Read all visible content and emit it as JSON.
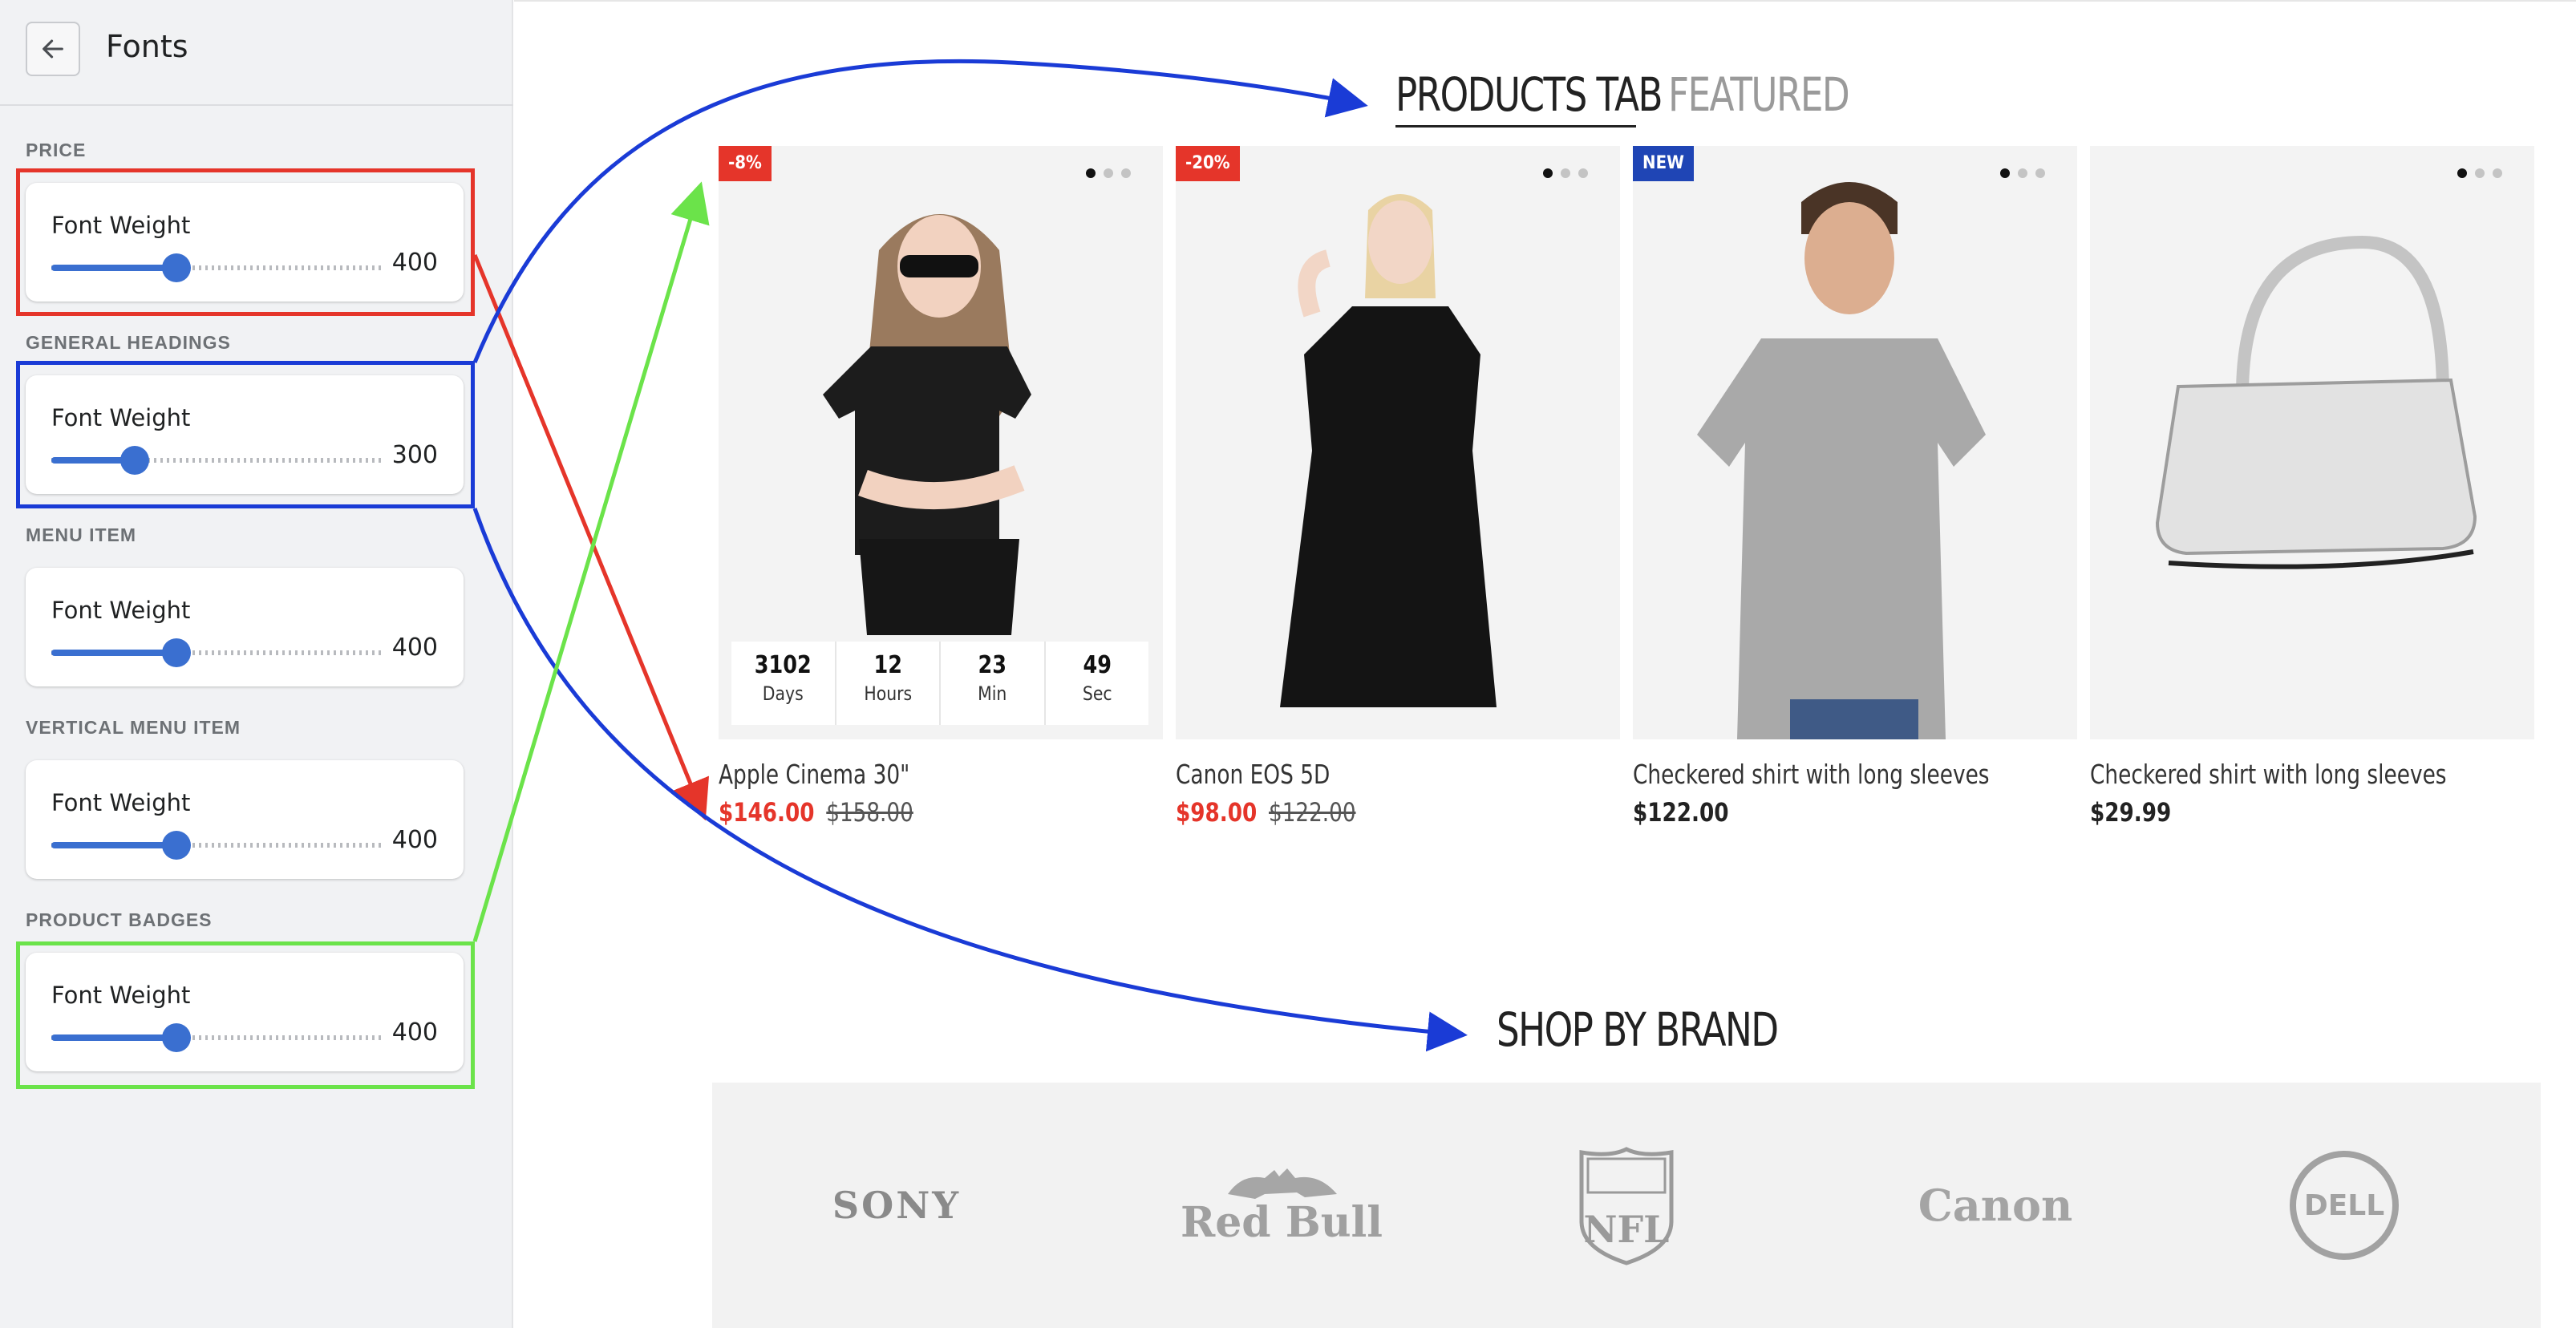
{
  "sidebar": {
    "title": "Fonts",
    "back_icon": "arrow-left-icon",
    "sections": [
      {
        "label": "PRICE",
        "control": {
          "label": "Font Weight",
          "value": "400",
          "fraction": 0.375
        }
      },
      {
        "label": "GENERAL HEADINGS",
        "control": {
          "label": "Font Weight",
          "value": "300",
          "fraction": 0.25
        }
      },
      {
        "label": "MENU ITEM",
        "control": {
          "label": "Font Weight",
          "value": "400",
          "fraction": 0.375
        }
      },
      {
        "label": "VERTICAL MENU ITEM",
        "control": {
          "label": "Font Weight",
          "value": "400",
          "fraction": 0.375
        }
      },
      {
        "label": "PRODUCT BADGES",
        "control": {
          "label": "Font Weight",
          "value": "400",
          "fraction": 0.375
        }
      }
    ],
    "highlight_colors": {
      "price": "#e5352a",
      "headings": "#1a3bd6",
      "badges": "#6be34a"
    }
  },
  "store": {
    "tabs": {
      "active": "PRODUCTS TAB",
      "inactive": "FEATURED"
    },
    "products": [
      {
        "name": "Apple Cinema 30\"",
        "price": "$146.00",
        "old_price": "$158.00",
        "badge": "-8%",
        "badge_color": "#e5352a",
        "sale": true,
        "countdown": [
          {
            "num": "3102",
            "unit": "Days"
          },
          {
            "num": "12",
            "unit": "Hours"
          },
          {
            "num": "23",
            "unit": "Min"
          },
          {
            "num": "49",
            "unit": "Sec"
          }
        ]
      },
      {
        "name": "Canon EOS 5D",
        "price": "$98.00",
        "old_price": "$122.00",
        "badge": "-20%",
        "badge_color": "#e5352a",
        "sale": true
      },
      {
        "name": "Checkered shirt with long sleeves",
        "price": "$122.00",
        "badge": "NEW",
        "badge_color": "#1f45b5",
        "sale": false
      },
      {
        "name": "Checkered shirt with long sleeves",
        "price": "$29.99",
        "sale": false
      }
    ],
    "brand_title": "SHOP BY BRAND",
    "brands": [
      "SONY",
      "Red Bull",
      "NFL",
      "Canon",
      "DELL"
    ]
  }
}
